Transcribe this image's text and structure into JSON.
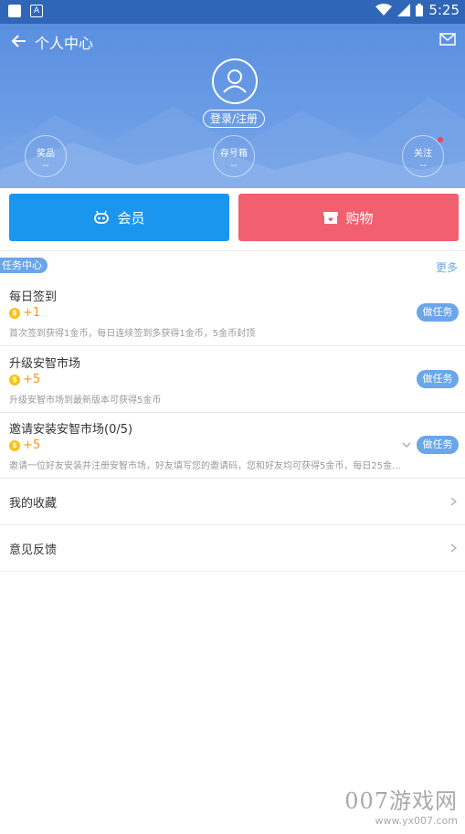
{
  "status_bar": {
    "time": "5:25",
    "left_icons": [
      "app-icon",
      "notification-icon"
    ],
    "right_icons": [
      "wifi-icon",
      "signal-icon",
      "battery-icon"
    ]
  },
  "header": {
    "title": "个人中心",
    "login_label": "登录/注册",
    "stats": [
      {
        "label": "奖品",
        "value": "--"
      },
      {
        "label": "存号箱",
        "value": "--"
      },
      {
        "label": "关注",
        "value": "--"
      }
    ]
  },
  "actions": {
    "vip_label": "会员",
    "shop_label": "购物"
  },
  "tasks_section": {
    "title": "任务中心",
    "more_label": "更多"
  },
  "tasks": [
    {
      "name": "每日签到",
      "reward": "+1",
      "desc": "首次签到获得1金币，每日连续签到多获得1金币，5金币封顶",
      "button": "做任务"
    },
    {
      "name": "升级安智市场",
      "reward": "+5",
      "desc": "升级安智市场到最新版本可获得5金币",
      "button": "做任务"
    },
    {
      "name": "邀请安装安智市场(0/5)",
      "reward": "+5",
      "desc": "邀请一位好友安装并注册安智市场，好友填写您的邀请码，您和好友均可获得5金币，每日25金...",
      "button": "做任务"
    }
  ],
  "menu": [
    {
      "label": "我的收藏"
    },
    {
      "label": "意见反馈"
    }
  ],
  "watermark": {
    "line1": "007游戏网",
    "line2": "www.yx007.com"
  },
  "colors": {
    "header": "#5a8fe0",
    "vip": "#1a96ef",
    "shop": "#f25f6f",
    "accent": "#69a6ea",
    "coin": "#f7c21c",
    "reward": "#f39a1e"
  }
}
